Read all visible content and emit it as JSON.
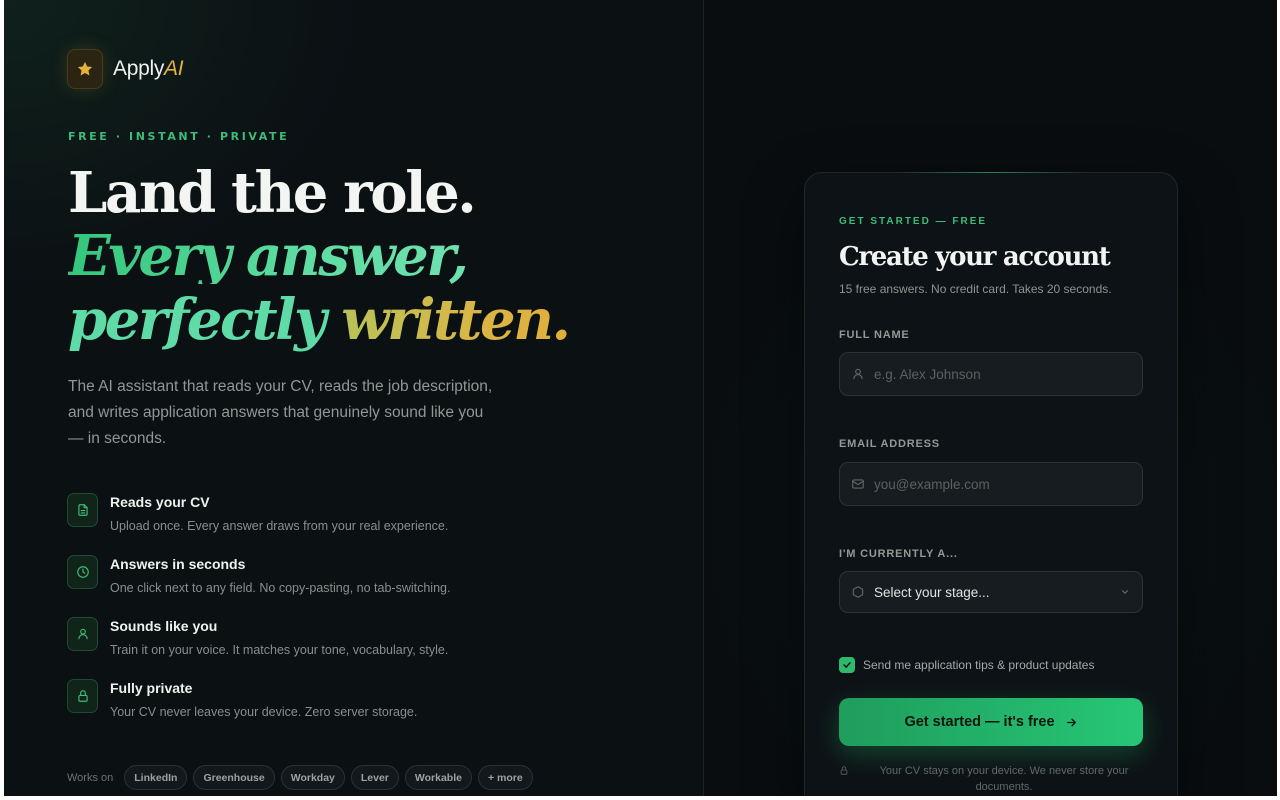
{
  "brand": {
    "name": "Apply",
    "accent": "AI",
    "logo_icon": "star-icon",
    "accent_color": "#e3b23c"
  },
  "hero": {
    "eyebrow": "FREE · INSTANT · PRIVATE",
    "line1": "Land the role.",
    "line2": "Every answer,",
    "line3_a": "perfectly",
    "line3_b": "written.",
    "lede": "The AI assistant that reads your CV, reads the job description, and writes application answers that genuinely sound like you — in seconds."
  },
  "features": [
    {
      "icon": "document-icon",
      "title": "Reads your CV",
      "desc": "Upload once. Every answer draws from your real experience."
    },
    {
      "icon": "clock-icon",
      "title": "Answers in seconds",
      "desc": "One click next to any field. No copy-pasting, no tab-switching."
    },
    {
      "icon": "user-icon",
      "title": "Sounds like you",
      "desc": "Train it on your voice. It matches your tone, vocabulary, style."
    },
    {
      "icon": "lock-icon",
      "title": "Fully private",
      "desc": "Your CV never leaves your device. Zero server storage."
    }
  ],
  "works_on": {
    "label": "Works on",
    "platforms": [
      "LinkedIn",
      "Greenhouse",
      "Workday",
      "Lever",
      "Workable",
      "+ more"
    ]
  },
  "signup": {
    "eyebrow": "GET STARTED — FREE",
    "title": "Create your account",
    "subtitle": "15 free answers. No credit card. Takes 20 seconds.",
    "name_label": "FULL NAME",
    "name_placeholder": "e.g. Alex Johnson",
    "email_label": "EMAIL ADDRESS",
    "email_placeholder": "you@example.com",
    "stage_label": "I'M CURRENTLY A...",
    "stage_value": "Select your stage...",
    "updates_checked": true,
    "updates_label": "Send me application tips & product updates",
    "cta_label": "Get started — it's free",
    "privacy_note": "Your CV stays on your device. We never store your documents."
  },
  "colors": {
    "primary_green": "#27c776",
    "background": "#0b1013",
    "gold": "#e2ae3a"
  }
}
